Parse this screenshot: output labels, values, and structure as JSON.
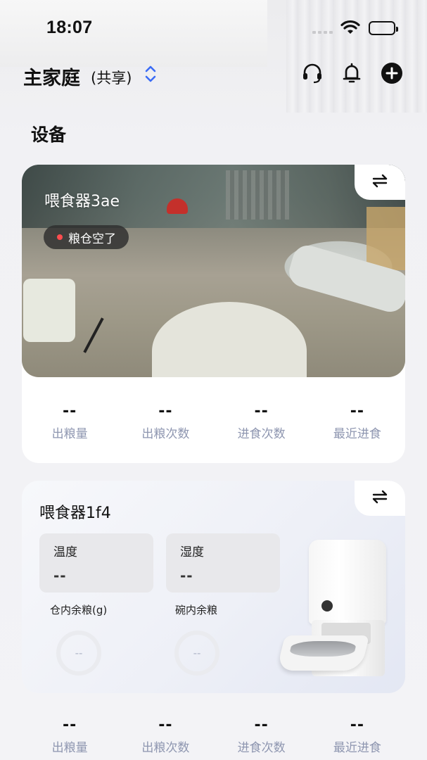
{
  "status_bar": {
    "time": "18:07"
  },
  "header": {
    "home_name": "主家庭",
    "home_shared": "(共享)"
  },
  "section": {
    "title": "设备"
  },
  "devices": [
    {
      "name": "喂食器3ae",
      "alert": "粮仓空了",
      "stats": [
        {
          "value": "--",
          "label": "出粮量"
        },
        {
          "value": "--",
          "label": "出粮次数"
        },
        {
          "value": "--",
          "label": "进食次数"
        },
        {
          "value": "--",
          "label": "最近进食"
        }
      ]
    },
    {
      "name": "喂食器1f4",
      "temperature": {
        "label": "温度",
        "value": "--"
      },
      "humidity": {
        "label": "湿度",
        "value": "--"
      },
      "bin_remaining": {
        "label": "仓内余粮(g)",
        "value": "--"
      },
      "bowl_remaining": {
        "label": "碗内余粮",
        "value": "--"
      },
      "stats": [
        {
          "value": "--",
          "label": "出粮量"
        },
        {
          "value": "--",
          "label": "出粮次数"
        },
        {
          "value": "--",
          "label": "进食次数"
        },
        {
          "value": "--",
          "label": "最近进食"
        }
      ]
    }
  ],
  "icons": {
    "home_switch": "chevron-up-down-icon",
    "support": "headset-icon",
    "notifications": "bell-icon",
    "add": "plus-circle-icon",
    "view_switch": "swap-arrows-icon"
  },
  "colors": {
    "accent": "#3b6cf5",
    "alert_dot": "#ff4d4f",
    "stat_label": "#8e96b0"
  }
}
